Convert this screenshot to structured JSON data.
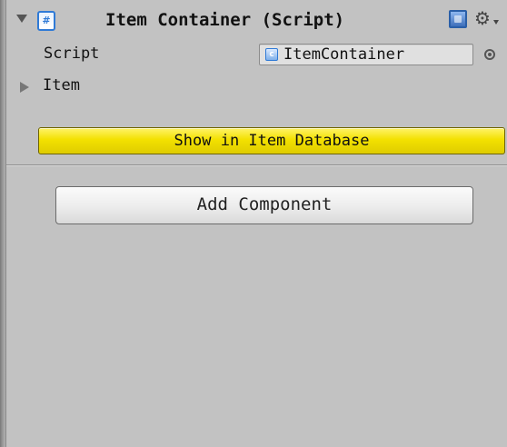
{
  "component": {
    "title": "Item Container (Script)",
    "icon": "csharp-script-icon",
    "icon_glyph": "#",
    "gear_glyph": "⚙"
  },
  "fields": {
    "script_label": "Script",
    "script_value": "ItemContainer",
    "script_icon_glyph": "c",
    "item_label": "Item"
  },
  "buttons": {
    "show_db": "Show in Item Database",
    "add_component": "Add Component"
  },
  "colors": {
    "accent_yellow": "#f3e100",
    "background": "#c2c2c2",
    "script_icon_blue": "#2f7ad6"
  }
}
